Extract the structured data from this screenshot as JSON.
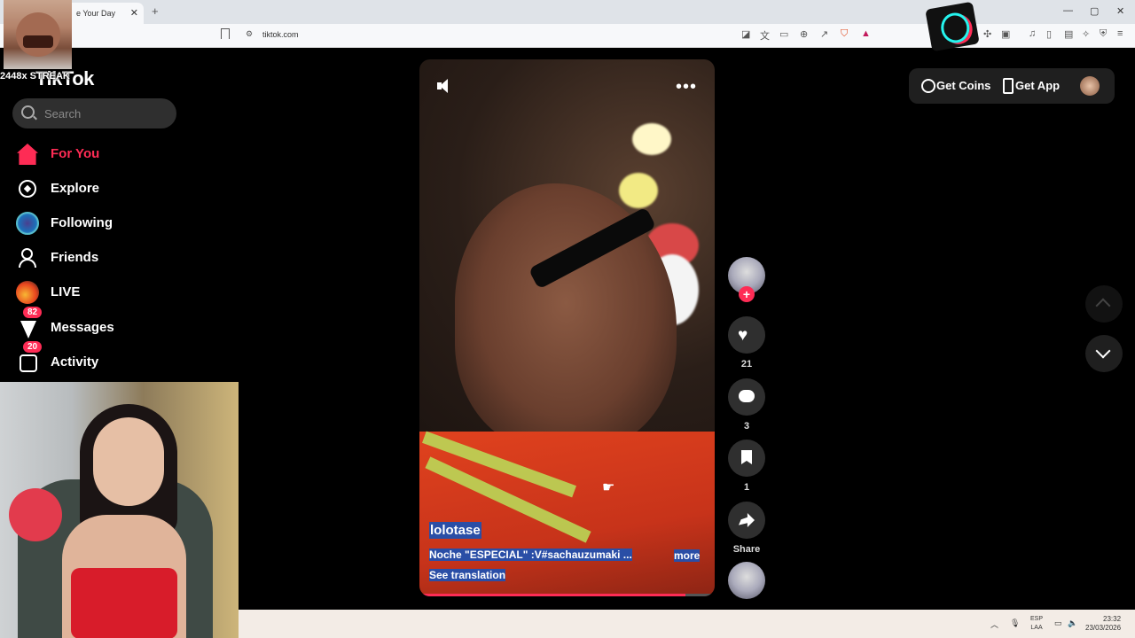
{
  "browser": {
    "tab_title": "e Your Day",
    "tab_close": "✕",
    "new_tab": "+",
    "url": "tiktok.com",
    "window_controls": [
      "—",
      "▢",
      "✕"
    ]
  },
  "overlay": {
    "streak_text": "2448x STREAK"
  },
  "brand": {
    "logo": "TikTok",
    "accent": "#fe2c55"
  },
  "search": {
    "placeholder": "Search"
  },
  "sidebar": {
    "items": [
      {
        "label": "For You",
        "icon": "home-icon"
      },
      {
        "label": "Explore",
        "icon": "compass-icon"
      },
      {
        "label": "Following",
        "icon": "following-avatar-icon"
      },
      {
        "label": "Friends",
        "icon": "friends-icon"
      },
      {
        "label": "LIVE",
        "icon": "live-icon"
      },
      {
        "label": "Messages",
        "icon": "inbox-icon",
        "badge": "82"
      },
      {
        "label": "Activity",
        "icon": "activity-icon",
        "badge": "20"
      }
    ]
  },
  "video": {
    "author": "lolotase",
    "caption": "Noche \"ESPECIAL\" :V#sachauzumaki ...",
    "more": "more",
    "see_translation": "See translation",
    "progress": 0.9
  },
  "actions": {
    "likes": "21",
    "comments": "3",
    "saves": "1",
    "share_label": "Share",
    "follow_plus": "+"
  },
  "header_right": {
    "get_coins": "Get Coins",
    "get_app": "Get App"
  },
  "taskbar": {
    "lang_top": "ESP",
    "lang_bottom": "LAA",
    "time": "23:32",
    "date": "23/03/2026"
  }
}
